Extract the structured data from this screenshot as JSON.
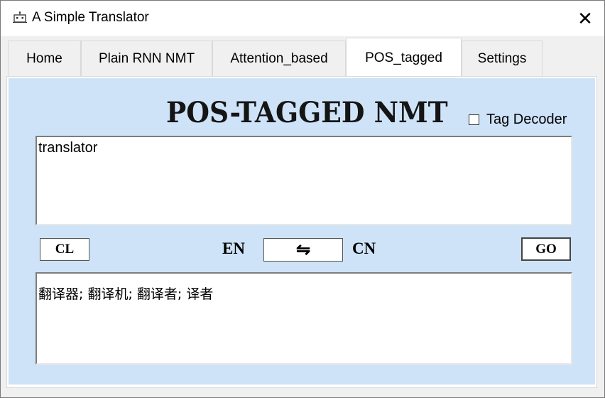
{
  "window": {
    "title": "A Simple Translator",
    "app_icon": "robot-icon",
    "close_glyph": "✕"
  },
  "tabs": [
    {
      "label": "Home",
      "active": false
    },
    {
      "label": "Plain RNN NMT",
      "active": false
    },
    {
      "label": "Attention_based",
      "active": false
    },
    {
      "label": "POS_tagged",
      "active": true
    },
    {
      "label": "Settings",
      "active": false
    }
  ],
  "panel": {
    "heading": "POS-TAGGED NMT",
    "tag_decoder": {
      "label": "Tag Decoder",
      "checked": false
    },
    "input_text": "translator",
    "output_text": "翻译器; 翻译机; 翻译者; 译者",
    "buttons": {
      "clear": "CL",
      "go": "GO",
      "swap_glyph": "⇋"
    },
    "source_lang": "EN",
    "target_lang": "CN"
  },
  "colors": {
    "panel_background": "#cfe3f8",
    "tab_background": "#f0f0f0",
    "active_tab_background": "#ffffff"
  }
}
